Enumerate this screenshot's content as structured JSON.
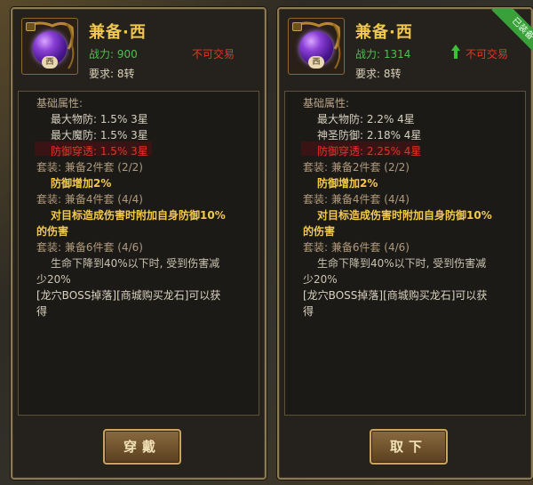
{
  "left": {
    "name": "兼备·西",
    "power_label": "战力:",
    "power_value": "900",
    "trade": "不可交易",
    "requirement": "要求: 8转",
    "gem_char": "西",
    "lines": [
      {
        "text": "基础属性:",
        "style": "head"
      },
      {
        "text": "最大物防: 1.5%  3星",
        "style": "stat"
      },
      {
        "text": "最大魔防: 1.5%  3星",
        "style": "stat"
      },
      {
        "text": "防御穿透: 1.5%  3星",
        "style": "red"
      },
      {
        "text": "套装: 兼备2件套 (2/2)",
        "style": "set"
      },
      {
        "text": "防御增加2%",
        "style": "eff"
      },
      {
        "text": "套装: 兼备4件套 (4/4)",
        "style": "set"
      },
      {
        "text": "对目标造成伤害时附加自身防御10%",
        "style": "eff"
      },
      {
        "text": "的伤害",
        "style": "eff"
      },
      {
        "text": "套装: 兼备6件套 (4/6)",
        "style": "set"
      },
      {
        "text": "生命下降到40%以下时, 受到伤害减",
        "style": "desc"
      },
      {
        "text": "少20%",
        "style": "desc"
      },
      {
        "text": "[龙穴BOSS掉落][商城购买龙石]可以获",
        "style": "src"
      },
      {
        "text": "得",
        "style": "src"
      }
    ],
    "button": "穿戴"
  },
  "right": {
    "name": "兼备·西",
    "power_label": "战力:",
    "power_value": "1314",
    "trade": "不可交易",
    "requirement": "要求: 8转",
    "gem_char": "西",
    "ribbon": "已装备",
    "lines": [
      {
        "text": "基础属性:",
        "style": "head"
      },
      {
        "text": "最大物防: 2.2%  4星",
        "style": "stat"
      },
      {
        "text": "神圣防御: 2.18%  4星",
        "style": "stat"
      },
      {
        "text": "防御穿透: 2.25%  4星",
        "style": "red"
      },
      {
        "text": "套装: 兼备2件套 (2/2)",
        "style": "set"
      },
      {
        "text": "防御增加2%",
        "style": "eff"
      },
      {
        "text": "套装: 兼备4件套 (4/4)",
        "style": "set"
      },
      {
        "text": "对目标造成伤害时附加自身防御10%",
        "style": "eff"
      },
      {
        "text": "的伤害",
        "style": "eff"
      },
      {
        "text": "套装: 兼备6件套 (4/6)",
        "style": "set"
      },
      {
        "text": "生命下降到40%以下时, 受到伤害减",
        "style": "desc"
      },
      {
        "text": "少20%",
        "style": "desc"
      },
      {
        "text": "[龙穴BOSS掉落][商城购买龙石]可以获",
        "style": "src"
      },
      {
        "text": "得",
        "style": "src"
      }
    ],
    "button": "取下"
  },
  "colors": {
    "gold": "#f0c850",
    "power_green": "#4fbf4f",
    "trade_red": "#e03a22",
    "ribbon_green": "#3aa03a"
  }
}
